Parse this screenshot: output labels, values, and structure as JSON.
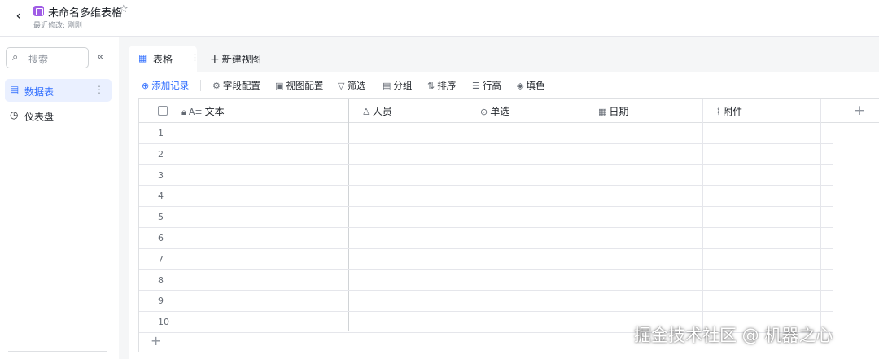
{
  "header": {
    "back_icon": "chevron-left-icon",
    "app_icon": "base-table-icon",
    "title": "未命名多维表格",
    "star_icon": "star-icon",
    "subtitle": "最近修改: 刚刚"
  },
  "sidebar": {
    "search_placeholder": "搜索",
    "collapse_glyph": "«",
    "items": [
      {
        "label": "数据表",
        "icon": "table-icon",
        "active": true
      },
      {
        "label": "仪表盘",
        "icon": "dashboard-icon",
        "active": false
      }
    ]
  },
  "tabs": {
    "active_label": "表格",
    "new_view_label": "新建视图"
  },
  "toolbar": {
    "add_record": "添加记录",
    "field_config": "字段配置",
    "view_config": "视图配置",
    "filter": "筛选",
    "group": "分组",
    "sort": "排序",
    "row_height": "行高",
    "fill_color": "填色"
  },
  "table": {
    "columns": [
      {
        "label": "文本",
        "icon": "text-field-icon"
      },
      {
        "label": "人员",
        "icon": "person-icon"
      },
      {
        "label": "单选",
        "icon": "single-select-icon"
      },
      {
        "label": "日期",
        "icon": "calendar-icon"
      },
      {
        "label": "附件",
        "icon": "attachment-icon"
      }
    ],
    "row_numbers": [
      "1",
      "2",
      "3",
      "4",
      "5",
      "6",
      "7",
      "8",
      "9",
      "10"
    ]
  },
  "watermark": "掘金技术社区 @ 机器之心",
  "colors": {
    "accent": "#3370ff",
    "app_icon": "#a05de6",
    "border": "#dee0e3",
    "background": "#f5f6f7"
  }
}
